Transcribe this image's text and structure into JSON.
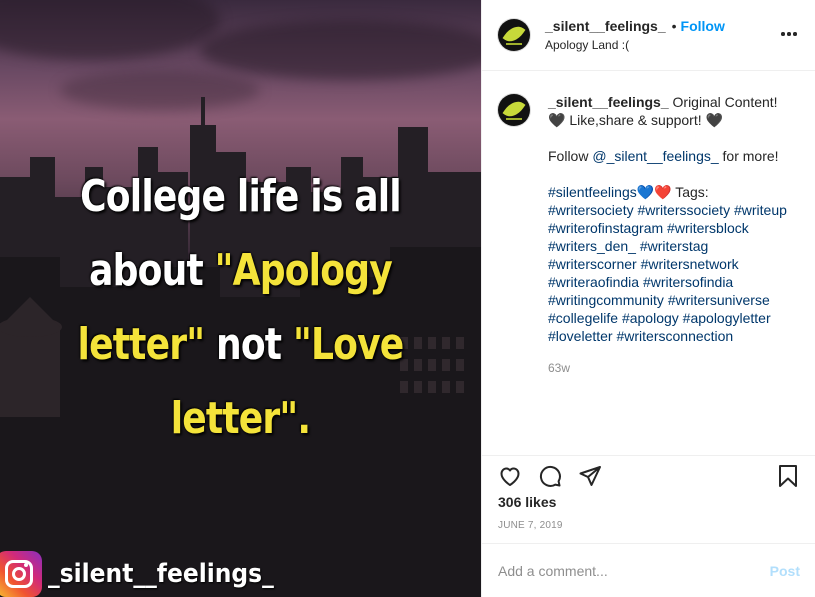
{
  "post_image": {
    "lines": [
      [
        {
          "text": "College life is all",
          "hl": false
        }
      ],
      [
        {
          "text": "about ",
          "hl": false
        },
        {
          "text": "\"Apology",
          "hl": true
        }
      ],
      [
        {
          "text": "letter\"",
          "hl": true
        },
        {
          "text": " not ",
          "hl": false
        },
        {
          "text": "\"Love",
          "hl": true
        }
      ],
      [
        {
          "text": "letter\".",
          "hl": true
        }
      ]
    ],
    "watermark_handle": "_silent__feelings_",
    "text_color": "#ffffff",
    "highlight_color": "#f4e33a"
  },
  "header": {
    "username": "_silent__feelings_",
    "separator": "•",
    "follow_label": "Follow",
    "location": "Apology Land :("
  },
  "caption": {
    "username": "_silent__feelings_",
    "line1": " Original Content! 🖤 Like,share & support! 🖤",
    "follow_prefix": "Follow ",
    "follow_mention": "@_silent__feelings_",
    "follow_suffix": " for more!",
    "tags_intro": [
      {
        "text": "#silentfeelings",
        "tag": true
      },
      {
        "text": "💙❤️ Tags:",
        "tag": false
      }
    ],
    "hashtags": [
      "#writersociety",
      "#writerssociety",
      "#writeup",
      "#writerofinstagram",
      "#writersblock",
      "#writers_den_",
      "#writerstag",
      "#writerscorner",
      "#writersnetwork",
      "#writeraofindia",
      "#writersofindia",
      "#writingcommunity",
      "#writersuniverse",
      "#collegelife",
      "#apology",
      "#apologyletter",
      "#loveletter",
      "#writersconnection"
    ],
    "time_ago": "63w"
  },
  "actions": {
    "like_icon": "heart-icon",
    "comment_icon": "comment-icon",
    "share_icon": "paper-plane-icon",
    "save_icon": "bookmark-icon"
  },
  "likes_text": "306 likes",
  "date_text": "JUNE 7, 2019",
  "comment_input": {
    "placeholder": "Add a comment...",
    "value": ""
  },
  "post_button": "Post",
  "colors": {
    "link_blue": "#0095f6",
    "hashtag": "#00376b",
    "muted": "#8e8e8e",
    "post_disabled": "#b2dffc"
  }
}
